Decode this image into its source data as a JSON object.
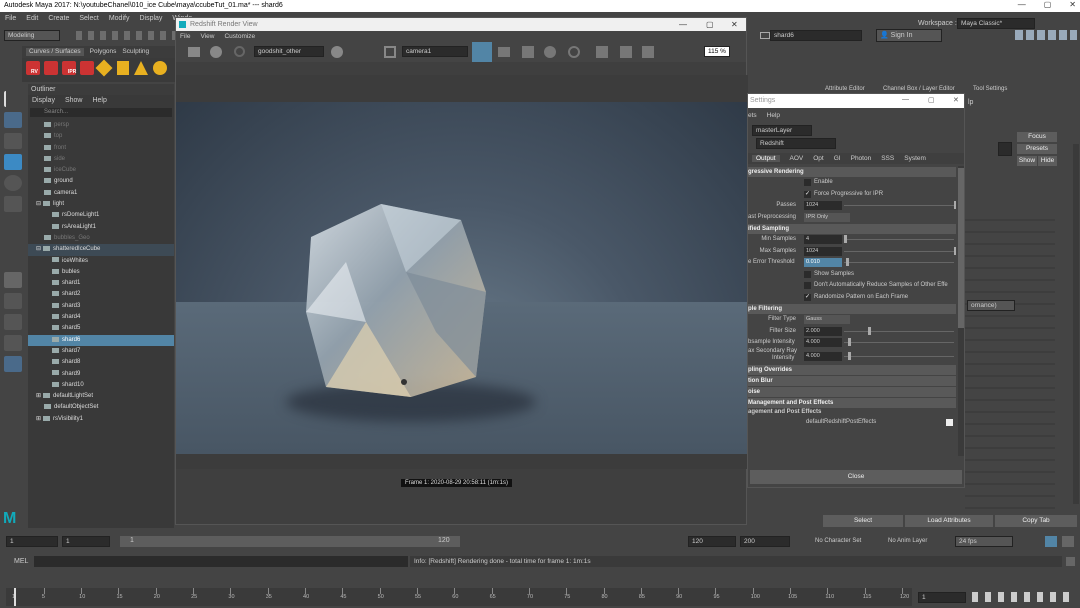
{
  "window": {
    "title": "Autodesk Maya 2017: N:\\youtubeChanel\\010_ice Cube\\maya\\ccubeTut_01.ma*   ---   shard6"
  },
  "menubar": [
    "File",
    "Edit",
    "Create",
    "Select",
    "Modify",
    "Display",
    "Windo"
  ],
  "toolbar": {
    "mode": "Modeling",
    "object_field": "shard6",
    "sign_in": "Sign In",
    "workspace_label": "Workspace :",
    "workspace_value": "Maya Classic*"
  },
  "shelf": {
    "tabs": [
      "Curves / Surfaces",
      "Polygons",
      "Sculpting"
    ],
    "icon_labels": [
      "RV",
      "IPR"
    ]
  },
  "outliner": {
    "title": "Outliner",
    "menu": [
      "Display",
      "Show",
      "Help"
    ],
    "search_placeholder": "Search...",
    "rows": [
      {
        "label": "persp",
        "dim": true,
        "indent": 1
      },
      {
        "label": "top",
        "dim": true,
        "indent": 1
      },
      {
        "label": "front",
        "dim": true,
        "indent": 1
      },
      {
        "label": "side",
        "dim": true,
        "indent": 1
      },
      {
        "label": "iceCube",
        "dim": true,
        "indent": 1
      },
      {
        "label": "ground",
        "indent": 1
      },
      {
        "label": "camera1",
        "indent": 1
      },
      {
        "label": "light",
        "indent": 0,
        "expand": "⊟"
      },
      {
        "label": "rsDomeLight1",
        "indent": 2
      },
      {
        "label": "rsAreaLight1",
        "indent": 2
      },
      {
        "label": "bubbles_Geo",
        "dim": true,
        "indent": 1
      },
      {
        "label": "shatteredIceCube",
        "indent": 0,
        "expand": "⊟",
        "grp": true
      },
      {
        "label": "iceWhites",
        "indent": 2
      },
      {
        "label": "bubles",
        "indent": 2
      },
      {
        "label": "shard1",
        "indent": 2
      },
      {
        "label": "shard2",
        "indent": 2
      },
      {
        "label": "shard3",
        "indent": 2
      },
      {
        "label": "shard4",
        "indent": 2
      },
      {
        "label": "shard5",
        "indent": 2
      },
      {
        "label": "shard6",
        "indent": 2,
        "sel": true
      },
      {
        "label": "shard7",
        "indent": 2
      },
      {
        "label": "shard8",
        "indent": 2
      },
      {
        "label": "shard9",
        "indent": 2
      },
      {
        "label": "shard10",
        "indent": 2
      },
      {
        "label": "defaultLightSet",
        "indent": 0,
        "expand": "⊞"
      },
      {
        "label": "defaultObjectSet",
        "indent": 1
      },
      {
        "label": "rsVisibility1",
        "indent": 0,
        "expand": "⊞"
      }
    ]
  },
  "render_view": {
    "title": "Redshift Render View",
    "menu": [
      "File",
      "View",
      "Customize"
    ],
    "snapshot": "goodshit_other",
    "camera": "camera1",
    "zoom": "115 %",
    "frame_info": "Frame  1:  2020-08-29  20:58:11  (1m:1s)"
  },
  "render_settings": {
    "title": "Settings",
    "menu": [
      "ets",
      "Help"
    ],
    "layer": "masterLayer",
    "renderer": "Redshift",
    "tabs": [
      "Output",
      "AOV",
      "Opt",
      "GI",
      "Photon",
      "SSS",
      "System"
    ],
    "sections": {
      "progressive": "gressive Rendering",
      "unified": "ified Sampling",
      "filtering": "ple Filtering",
      "overrides": "pling Overrides",
      "motion": "tion Blur",
      "noise": "oise",
      "post_mgmt": "Management and Post Effects",
      "post_sub": "agement and Post Effects"
    },
    "enable_label": "Enable",
    "force_prog_label": "Force Progressive for IPR",
    "passes_label": "Passes",
    "passes_value": "1024",
    "fast_label": "ast Preprocessing",
    "fast_value": "IPR Only",
    "min_samples_label": "Min Samples",
    "min_samples_value": "4",
    "max_samples_label": "Max Samples",
    "max_samples_value": "1024",
    "error_label": "e Error Threshold",
    "error_value": "0.010",
    "show_samples_label": "Show Samples",
    "dont_reduce_label": "Don't Automatically Reduce Samples of Other Effe",
    "randomize_label": "Randomize Pattern on Each Frame",
    "filter_type_label": "Filter Type",
    "filter_type_value": "Gauss",
    "filter_size_label": "Filter Size",
    "filter_size_value": "2.000",
    "subsample_label": "bsample Intensity",
    "subsample_value": "4.000",
    "maxsec_label1": "ax Secondary Ray",
    "maxsec_label2": "Intensity",
    "maxsec_value": "4.000",
    "post_effects_node": "defaultRedshiftPostEffects",
    "close": "Close"
  },
  "attribute_editor": {
    "tabs": [
      "Attribute Editor",
      "Channel Box / Layer Editor",
      "Tool Settings"
    ],
    "lp": "lp",
    "focus": "Focus",
    "presets": "Presets",
    "show": "Show",
    "hide": "Hide",
    "ornance": "ornance)",
    "select": "Select",
    "load_attributes": "Load Attributes",
    "copy_tab": "Copy Tab"
  },
  "time_slider": {
    "start": "1",
    "current": "1",
    "range_start": "1",
    "range_marker": "120",
    "end_inner": "120",
    "end_outer": "200",
    "character_set": "No Character Set",
    "anim_layer": "No Anim Layer",
    "fps": "24 fps"
  },
  "command_line": {
    "mel": "MEL",
    "message": "Info: [Redshift] Rendering done - total time for frame 1: 1m:1s"
  },
  "timeline": {
    "ticks": [
      "1",
      "5",
      "10",
      "15",
      "20",
      "25",
      "30",
      "35",
      "40",
      "45",
      "50",
      "55",
      "60",
      "65",
      "70",
      "75",
      "80",
      "85",
      "90",
      "95",
      "100",
      "105",
      "110",
      "115",
      "120"
    ],
    "current_frame": "1"
  }
}
